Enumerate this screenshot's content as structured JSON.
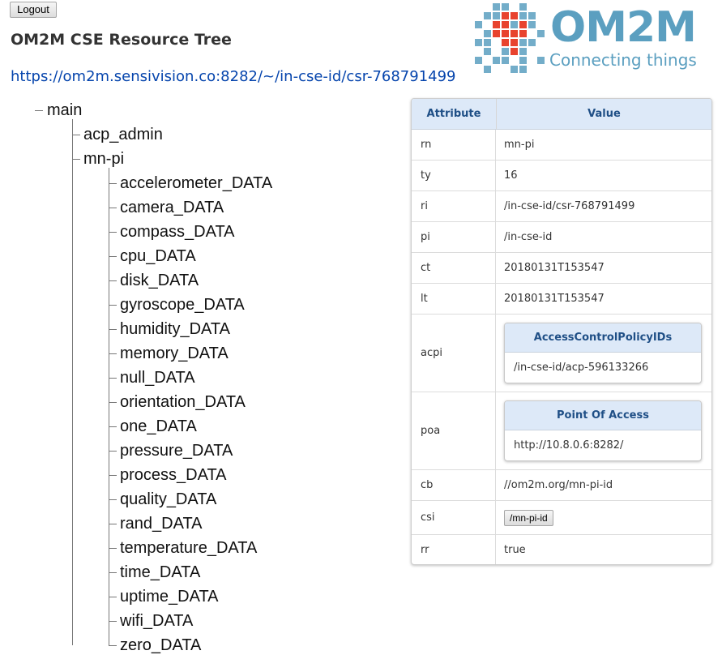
{
  "logout_label": "Logout",
  "page_title": "OM2M CSE Resource Tree",
  "cse_url": "https://om2m.sensivision.co:8282/~/in-cse-id/csr-768791499",
  "logo": {
    "word": "OM2M",
    "tagline": "Connecting things",
    "color": "#5b9fc0",
    "accent": "#e8432e"
  },
  "tree": {
    "root": "main",
    "children": [
      "acp_admin",
      "mn-pi"
    ],
    "mn_pi_children": [
      "accelerometer_DATA",
      "camera_DATA",
      "compass_DATA",
      "cpu_DATA",
      "disk_DATA",
      "gyroscope_DATA",
      "humidity_DATA",
      "memory_DATA",
      "null_DATA",
      "orientation_DATA",
      "one_DATA",
      "pressure_DATA",
      "process_DATA",
      "quality_DATA",
      "rand_DATA",
      "temperature_DATA",
      "time_DATA",
      "uptime_DATA",
      "wifi_DATA",
      "zero_DATA"
    ]
  },
  "table": {
    "headers": {
      "attribute": "Attribute",
      "value": "Value"
    },
    "rows": [
      {
        "attr": "rn",
        "value": "mn-pi"
      },
      {
        "attr": "ty",
        "value": "16"
      },
      {
        "attr": "ri",
        "value": "/in-cse-id/csr-768791499"
      },
      {
        "attr": "pi",
        "value": "/in-cse-id"
      },
      {
        "attr": "ct",
        "value": "20180131T153547"
      },
      {
        "attr": "lt",
        "value": "20180131T153547"
      },
      {
        "attr": "acpi",
        "box_title": "AccessControlPolicyIDs",
        "box_value": "/in-cse-id/acp-596133266"
      },
      {
        "attr": "poa",
        "box_title": "Point Of Access",
        "box_value": "http://10.8.0.6:8282/"
      },
      {
        "attr": "cb",
        "value": "//om2m.org/mn-pi-id"
      },
      {
        "attr": "csi",
        "button": "/mn-pi-id"
      },
      {
        "attr": "rr",
        "value": "true"
      }
    ]
  }
}
